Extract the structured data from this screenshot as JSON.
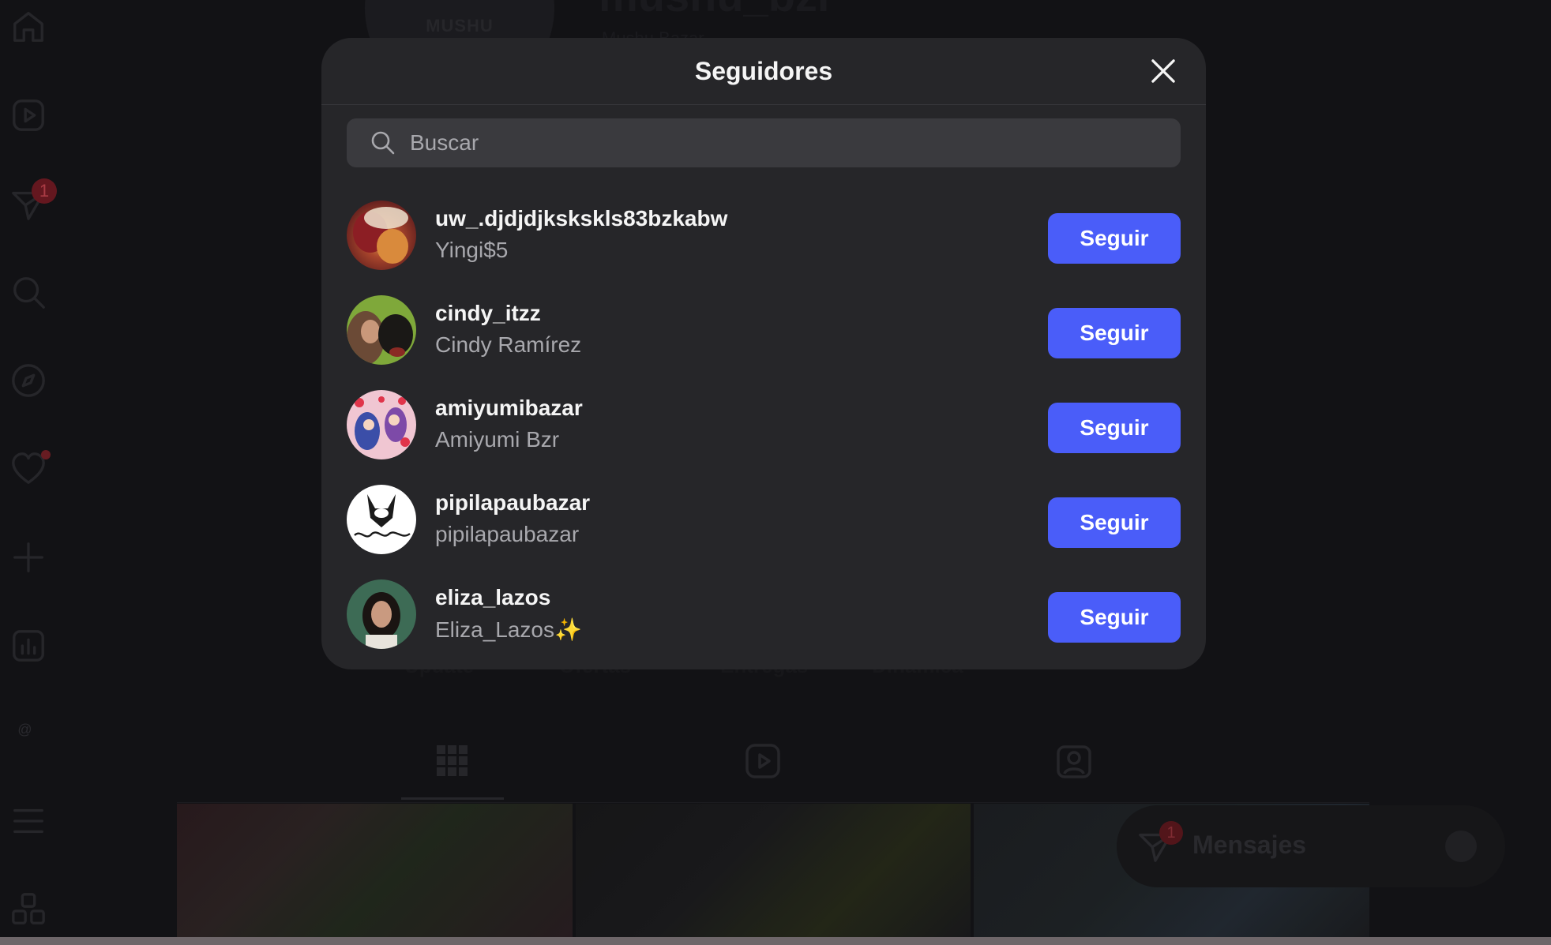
{
  "background": {
    "profile_avatar_text": "MUSHU",
    "profile_username": "mushu_bzr",
    "profile_name": "Mushu Bazar",
    "highlights": [
      "Update",
      "Ofertas",
      "Entregas",
      "Dinámica"
    ],
    "sidebar_notifications_badge": "1",
    "threads_mark": "@",
    "messages": {
      "label": "Mensajes",
      "badge": "1"
    }
  },
  "modal": {
    "title": "Seguidores",
    "search": {
      "placeholder": "Buscar",
      "value": ""
    },
    "followers": [
      {
        "username": "uw_.djdjdjkskskls83bzkabw",
        "name": "Yingi$5",
        "button": "Seguir"
      },
      {
        "username": "cindy_itzz",
        "name": "Cindy Ramírez",
        "button": "Seguir"
      },
      {
        "username": "amiyumibazar",
        "name": "Amiyumi Bzr",
        "button": "Seguir"
      },
      {
        "username": "pipilapaubazar",
        "name": "pipilapaubazar",
        "button": "Seguir"
      },
      {
        "username": "eliza_lazos",
        "name": "Eliza_Lazos✨",
        "button": "Seguir"
      }
    ]
  },
  "colors": {
    "accent": "#4a5df9",
    "modal_bg": "#262629",
    "page_bg": "#141417"
  }
}
